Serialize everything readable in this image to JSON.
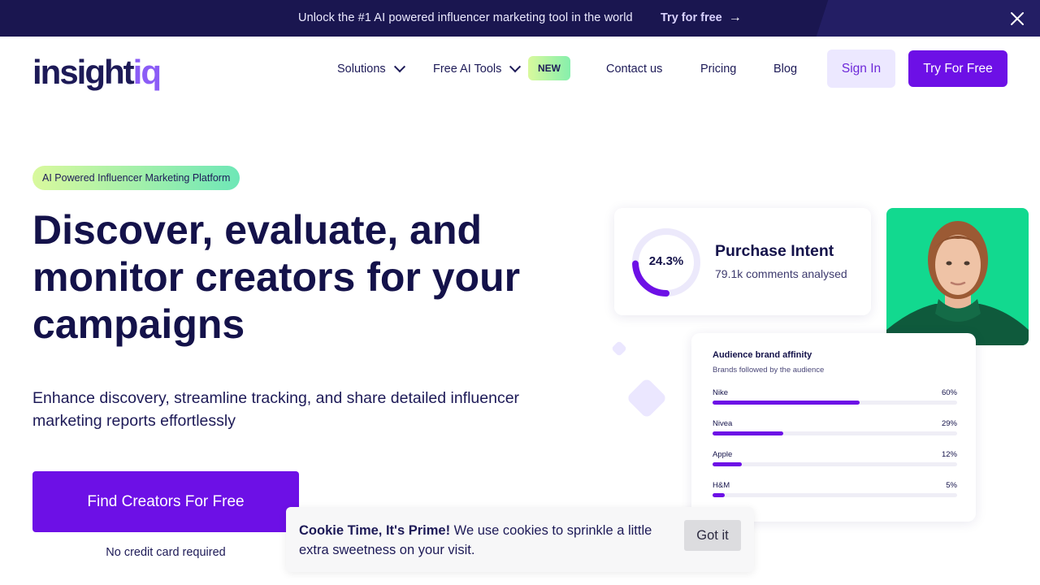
{
  "announcement": {
    "text": "Unlock the #1 AI powered influencer marketing tool in the world",
    "cta_label": "Try for free",
    "cta_icon": "arrow-right-icon",
    "close_icon": "close-icon"
  },
  "header": {
    "logo_main": "insight",
    "logo_accent": "iq",
    "nav": [
      {
        "label": "Solutions",
        "icon": "chevron-down-icon"
      },
      {
        "label": "Free AI Tools",
        "icon": "chevron-down-icon",
        "badge": "NEW"
      },
      {
        "label": "Contact us"
      },
      {
        "label": "Pricing"
      },
      {
        "label": "Blog"
      }
    ],
    "signin_label": "Sign In",
    "try_label": "Try For Free"
  },
  "hero": {
    "pill": "AI Powered Influencer Marketing Platform",
    "headline": "Discover, evaluate, and monitor creators for your campaigns",
    "subcopy": "Enhance discovery, streamline tracking, and share detailed influencer marketing reports effortlessly",
    "cta_label": "Find Creators For Free",
    "note": "No credit card required"
  },
  "illustration": {
    "intent": {
      "percent_label": "24.3%",
      "percent": 24.3,
      "title": "Purchase Intent",
      "subtitle": "79.1k comments analysed"
    },
    "affinity": {
      "title": "Audience brand affinity",
      "subtitle": "Brands followed by the audience",
      "brands": [
        {
          "name": "Nike",
          "pct_label": "60%",
          "pct": 60
        },
        {
          "name": "Nivea",
          "pct_label": "29%",
          "pct": 29
        },
        {
          "name": "Apple",
          "pct_label": "12%",
          "pct": 12
        },
        {
          "name": "H&M",
          "pct_label": "5%",
          "pct": 5
        }
      ]
    },
    "colors": {
      "accent": "#6d10e6",
      "photo_bg": "#12d98f"
    }
  },
  "cookie": {
    "title": "Cookie Time, It's Prime!",
    "text": " We use cookies to sprinkle a little extra sweetness on your visit.",
    "button_label": "Got it"
  }
}
